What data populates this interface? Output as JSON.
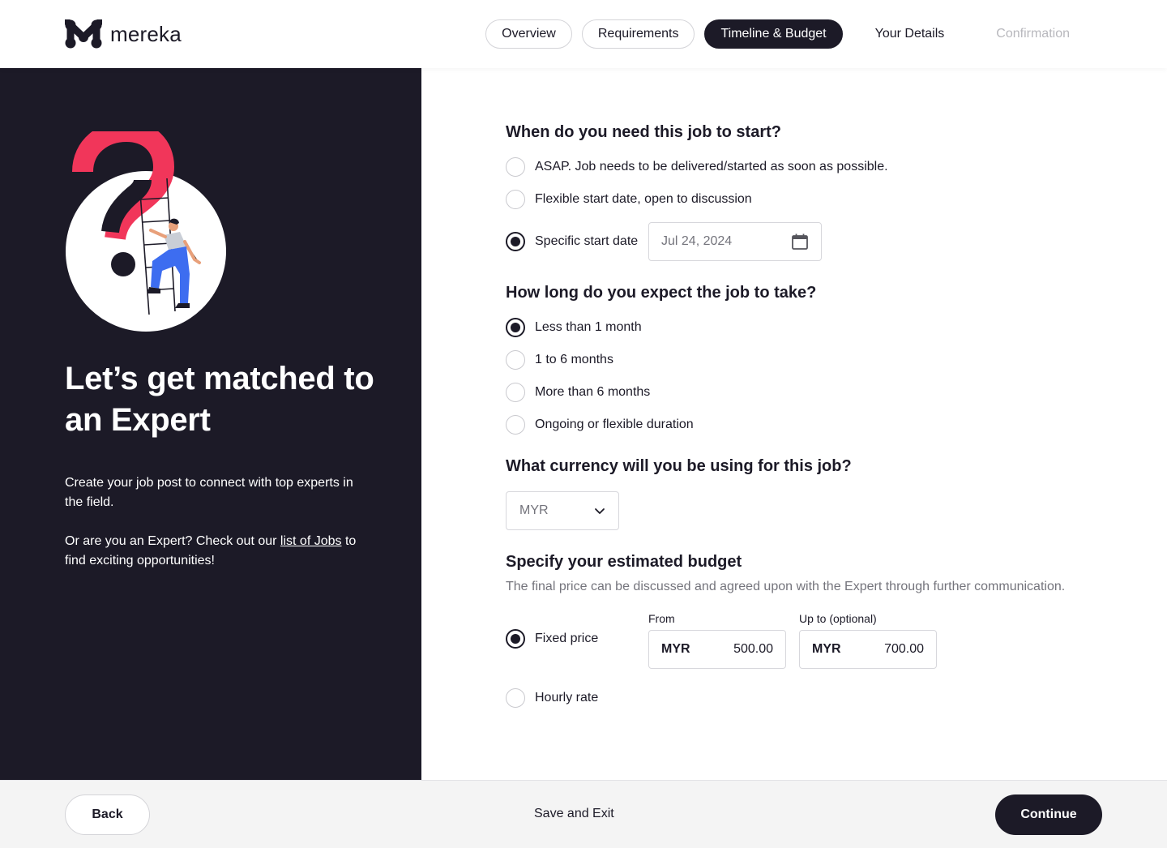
{
  "brand": {
    "name": "mereka",
    "logo_icon": "mereka-m-logo"
  },
  "steps": [
    {
      "label": "Overview",
      "state": "default"
    },
    {
      "label": "Requirements",
      "state": "default"
    },
    {
      "label": "Timeline & Budget",
      "state": "active"
    },
    {
      "label": "Your Details",
      "state": "upcoming"
    },
    {
      "label": "Confirmation",
      "state": "disabled"
    }
  ],
  "left": {
    "title": "Let’s get matched to an Expert",
    "paragraph1": "Create your job post to connect with top experts in the field.",
    "paragraph2_before": "Or are you an Expert? Check out our ",
    "paragraph2_link": "list of Jobs",
    "paragraph2_after_line1": " to",
    "paragraph2_after_line2": "find exciting opportunities!",
    "illustration": "question-mark-ladder-illustration",
    "colors": {
      "panel_bg": "#1c1a27",
      "accent_red": "#f1365a",
      "accent_blue": "#3d6df0"
    }
  },
  "start": {
    "question": "When do you need this job to start?",
    "options": [
      {
        "label": "ASAP. Job needs to be delivered/started as soon as possible.",
        "selected": false
      },
      {
        "label": "Flexible start date, open to discussion",
        "selected": false
      },
      {
        "label": "Specific start date",
        "selected": true
      }
    ],
    "date_value": "Jul 24, 2024",
    "date_icon": "calendar-icon"
  },
  "duration": {
    "question": "How long do you expect the job to take?",
    "options": [
      {
        "label": "Less than 1 month",
        "selected": true
      },
      {
        "label": "1 to 6 months",
        "selected": false
      },
      {
        "label": "More than 6 months",
        "selected": false
      },
      {
        "label": "Ongoing or flexible duration",
        "selected": false
      }
    ]
  },
  "currency": {
    "question": "What currency will you be using for this job?",
    "selected": "MYR",
    "icon": "chevron-down-icon"
  },
  "budget": {
    "question": "Specify your estimated budget",
    "subtitle": "The final price can be discussed and agreed upon with the Expert through further communication.",
    "from_label": "From",
    "upto_label": "Up to (optional)",
    "options": [
      {
        "label": "Fixed price",
        "selected": true
      },
      {
        "label": "Hourly rate",
        "selected": false
      }
    ],
    "from_currency": "MYR",
    "from_value": "500.00",
    "upto_currency": "MYR",
    "upto_value": "700.00"
  },
  "footer": {
    "back": "Back",
    "save_exit": "Save and Exit",
    "continue": "Continue"
  }
}
